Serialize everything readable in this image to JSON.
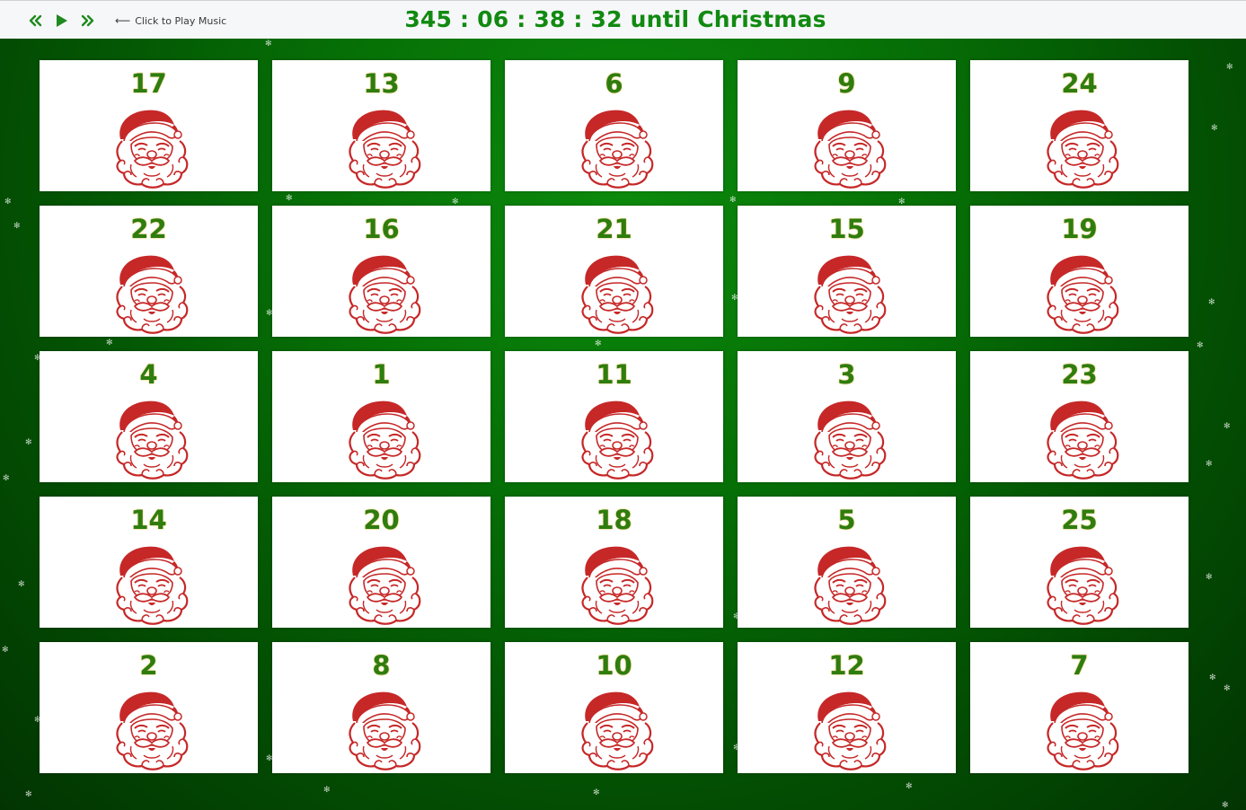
{
  "toolbar": {
    "music_hint": "Click to Play Music",
    "prev_icon": "double-chevron-left-icon",
    "play_icon": "play-icon",
    "next_icon": "double-chevron-right-icon"
  },
  "countdown": {
    "text": "345 : 06 : 38 : 32 until Christmas"
  },
  "colors": {
    "countdown": "#118a11",
    "door_number": "#2e7d0f",
    "santa": "#c62828",
    "background": "#067006"
  },
  "doors": [
    "17",
    "13",
    "6",
    "9",
    "24",
    "22",
    "16",
    "21",
    "15",
    "19",
    "4",
    "1",
    "11",
    "3",
    "23",
    "14",
    "20",
    "18",
    "5",
    "25",
    "2",
    "8",
    "10",
    "12",
    "7"
  ]
}
